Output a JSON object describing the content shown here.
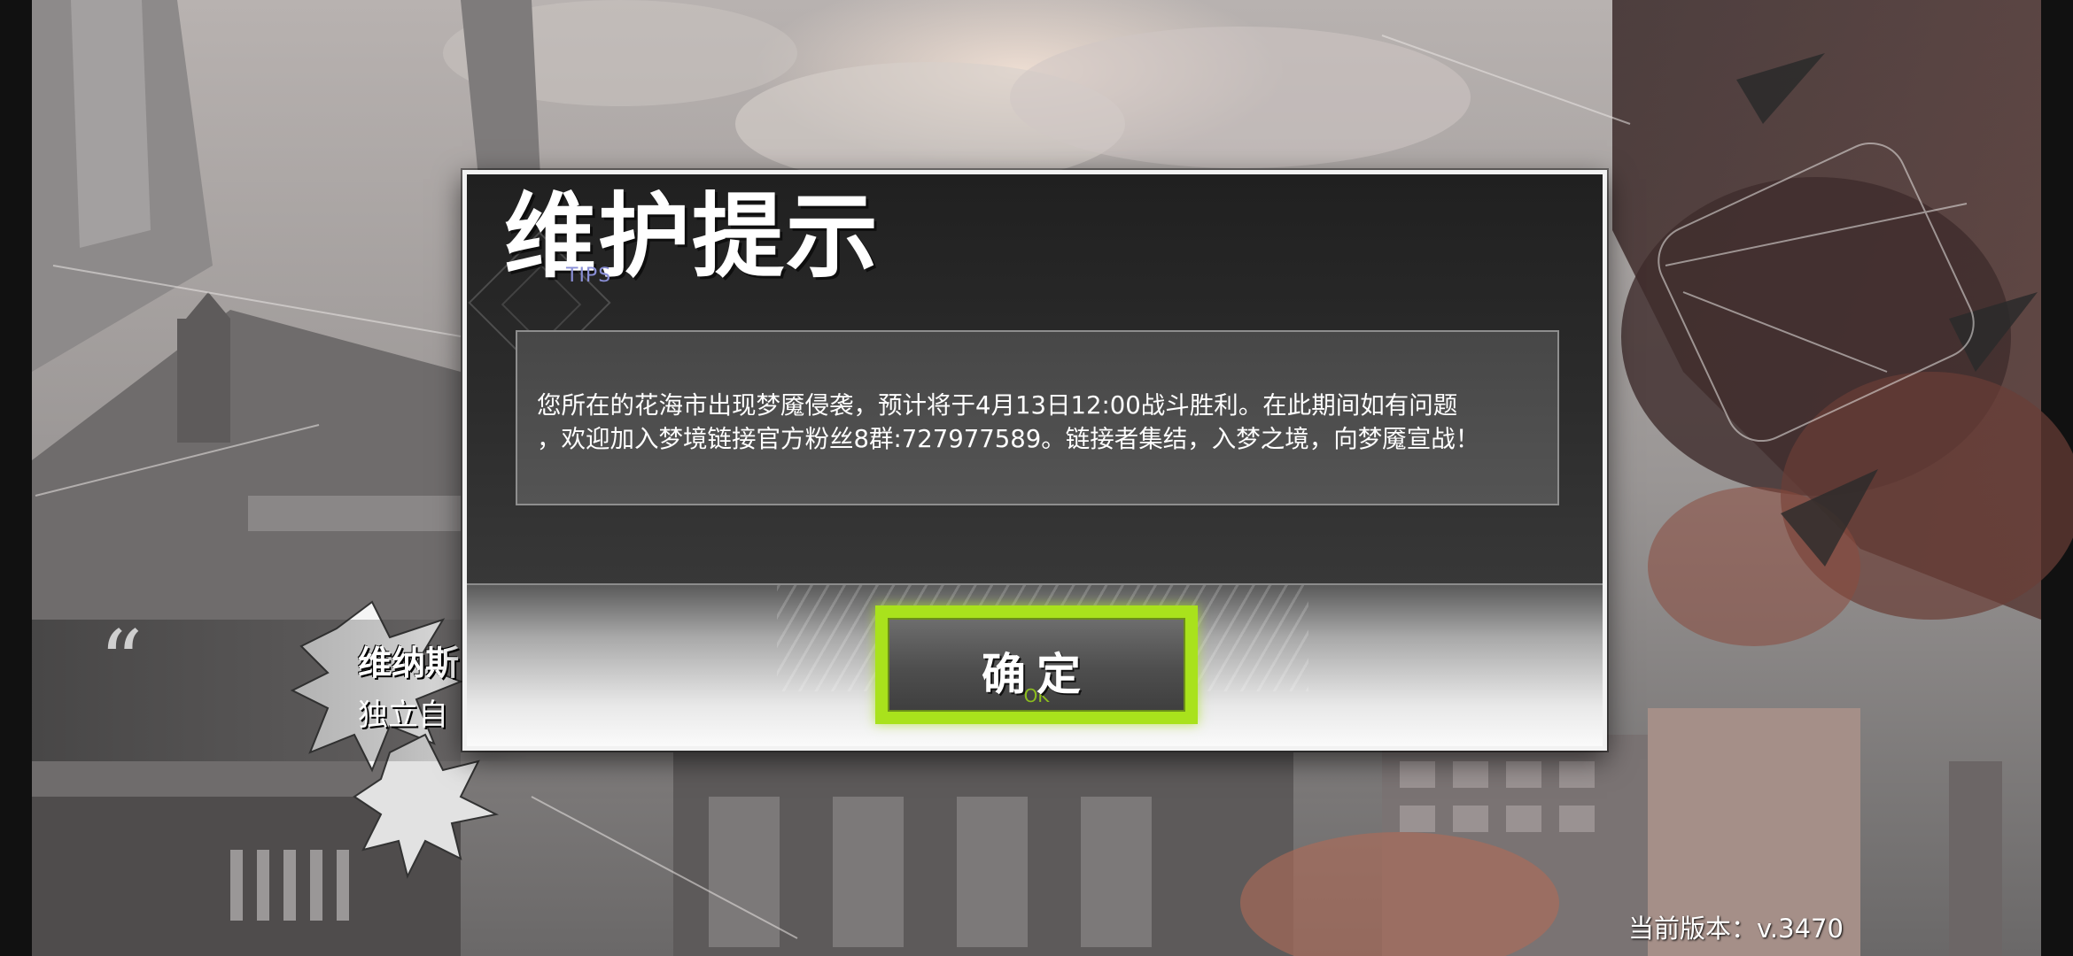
{
  "background": {
    "quote_mark": "“",
    "speaker_name": "维纳斯",
    "speaker_line": "独立自"
  },
  "dialog": {
    "title": "维护提示",
    "subtitle": "TIPS",
    "message": "您所在的花海市出现梦魇侵袭，预计将于4月13日12:00战斗胜利。在此期间如有问题\n，欢迎加入梦境链接官方粉丝8群:727977589。链接者集结，入梦之境，向梦魇宣战！",
    "confirm_label": "确定",
    "confirm_sub": "OK"
  },
  "footer": {
    "version_label": "当前版本：v.3470"
  },
  "colors": {
    "accent": "#a9e21c",
    "dialog_border": "#f2f2f2",
    "dialog_bg": "#2c2c2c",
    "subtitle": "#8a8fd6"
  }
}
